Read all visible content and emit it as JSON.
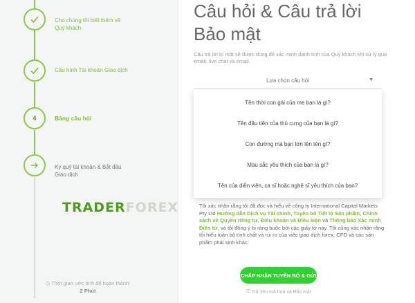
{
  "sidebar": {
    "steps": [
      {
        "label": "Cho chúng tôi biết thêm về Quý khách",
        "state": "done"
      },
      {
        "label": "Cấu hình Tài khoản Giao dịch",
        "state": "done"
      },
      {
        "label": "Bảng câu hỏi",
        "number": "4",
        "state": "active"
      },
      {
        "label": "Ký quỹ tài khoản & Bắt đầu Giao dịch",
        "state": "pending",
        "icon": "arrow-right-icon"
      }
    ],
    "time_label": "Thời gian ước tính để hoàn thành:",
    "time_value": "2 Phút"
  },
  "watermark": {
    "part1": "TRADER",
    "part2": "FOREX"
  },
  "main": {
    "title_line1": "Câu hỏi & Câu trả lời",
    "title_line2": "Bảo mật",
    "description": "Câu trả lời bí mật sẽ được dùng để xác minh danh tính của Quý khách khi xử lý qua email, live chat và email.",
    "select_placeholder": "Lựa chọn câu hỏi",
    "options": [
      "Tên thời con gái của mẹ bạn là gì?",
      "Tên đầu tiên của thú cưng của bạn là gì?",
      "Con đường mà bạn lớn lên tên gì?",
      "Màu sắc yêu thích của bạn là gì?",
      "Tên của diễn viên, ca sĩ hoặc nghệ sĩ yêu thích của bạn?"
    ],
    "agreement": {
      "t1": "Tôi xác nhận rằng tôi đã đọc và hiểu về công ty International Capital Markets Pty Ltd",
      "l1": "Hướng dẫn Dịch vụ Tài chính",
      "l2": "Tuyên bố Tiết lộ Sản phẩm",
      "l3": "Chính sách về Quyền riêng tư",
      "l4": "Điều khoản và Điều kiện",
      "and": "và",
      "l5": "Thông báo Xác minh Điện tử",
      "t2": ", và tôi đồng ý bị ràng buộc bởi các giấy tờ này. Tôi cũng xác nhận rằng tôi hiểu toàn bộ tính chất và rủi ro của việc giao dịch forex, CFD và các sản phẩm phái sinh khác."
    },
    "accept_button": "CHẤP NHẬN TUYÊN BỐ & GỬI",
    "secure_note": "Dữ liệu mã hoá và Bảo mật"
  },
  "colors": {
    "accent": "#8dc84a",
    "button": "#2fd12f",
    "link": "#7fbe3e"
  }
}
